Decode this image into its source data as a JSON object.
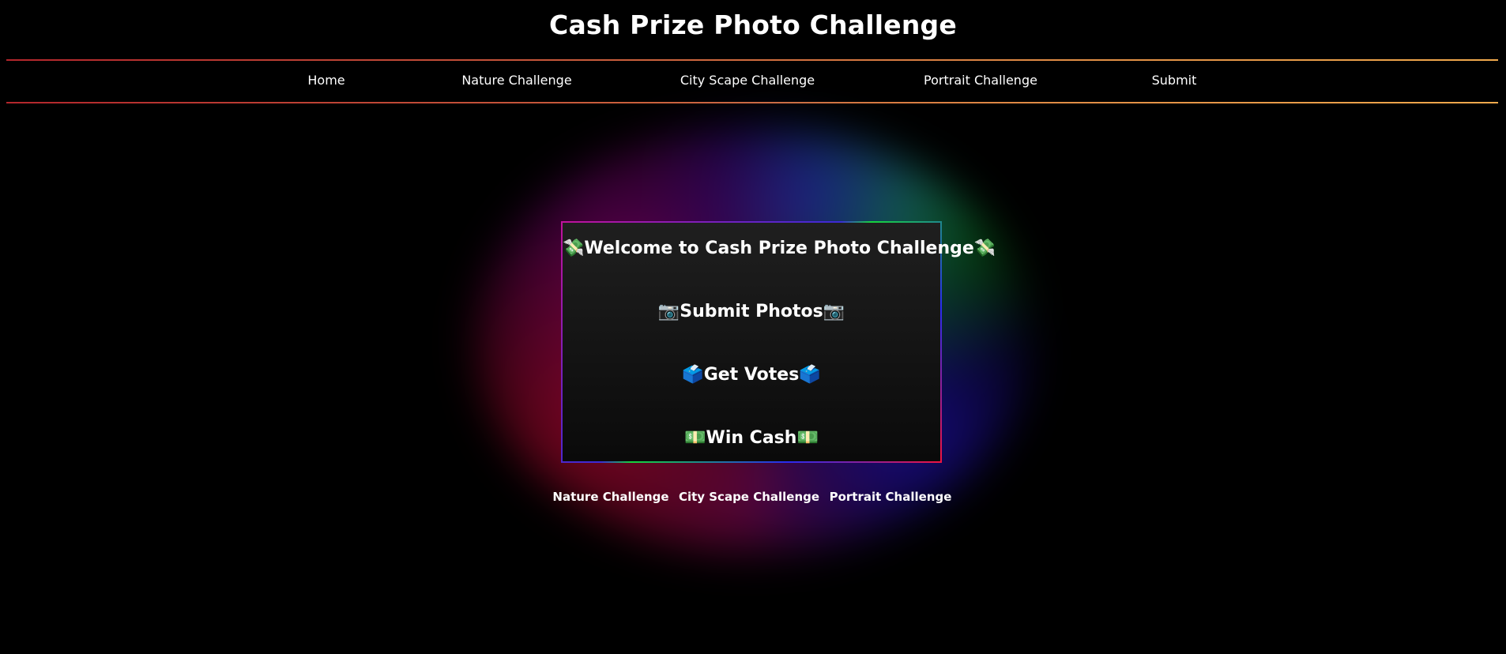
{
  "header": {
    "title": "Cash Prize Photo Challenge"
  },
  "nav": {
    "items": [
      {
        "label": "Home"
      },
      {
        "label": "Nature Challenge"
      },
      {
        "label": "City Scape Challenge"
      },
      {
        "label": "Portrait Challenge"
      },
      {
        "label": "Submit"
      }
    ]
  },
  "hero": {
    "lines": [
      {
        "icon": "💸",
        "text": "Welcome to Cash Prize Photo Challenge"
      },
      {
        "icon": "📷",
        "text": "Submit Photos"
      },
      {
        "icon": "🗳️",
        "text": "Get Votes"
      },
      {
        "icon": "💵",
        "text": "Win Cash"
      }
    ],
    "icon_names": [
      "money-with-wings-icon",
      "camera-icon",
      "ballot-box-icon",
      "dollar-banknote-icon"
    ]
  },
  "sub_links": [
    {
      "label": "Nature Challenge"
    },
    {
      "label": "City Scape Challenge"
    },
    {
      "label": "Portrait Challenge"
    }
  ],
  "colors": {
    "background": "#000000",
    "text": "#ffffff",
    "rule_start": "#b3262c",
    "rule_end": "#f0a94c",
    "glow_magenta": "#c1129b",
    "glow_blue": "#3b2bd6",
    "glow_green": "#16d43c",
    "glow_red": "#f01440"
  }
}
